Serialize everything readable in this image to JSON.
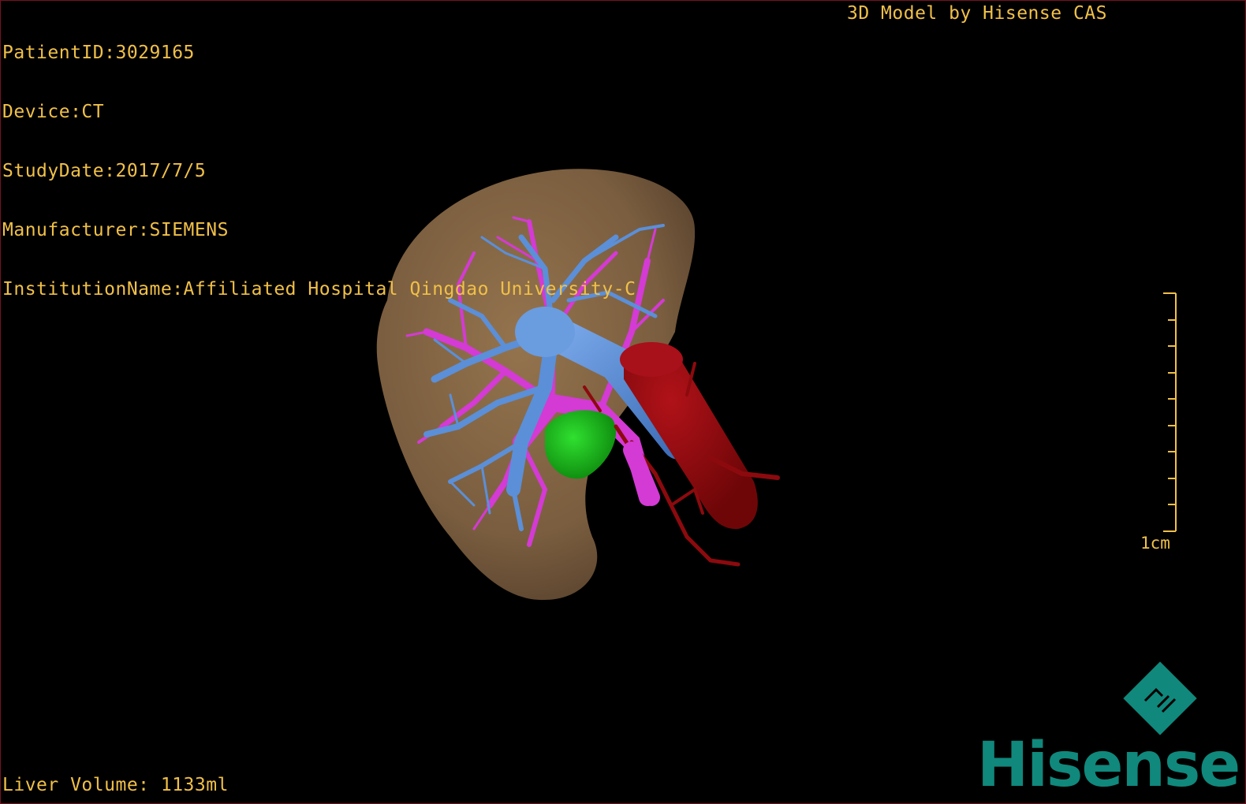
{
  "study_info": {
    "patient_id": "PatientID:3029165",
    "device": "Device:CT",
    "study_date": "StudyDate:2017/7/5",
    "manufacturer": "Manufacturer:SIEMENS",
    "institution": "InstitutionName:Affiliated Hospital Qingdao University-C"
  },
  "credit": "3D Model by Hisense CAS",
  "liver_volume": "Liver Volume: 1133ml",
  "scale_bar": {
    "label": "1cm",
    "tick_count": 10
  },
  "logo": {
    "wordmark": "Hisense",
    "emblem_icon": "hisense-diamond-emblem-icon"
  },
  "colors": {
    "overlay_text": "#f0c048",
    "liver": "#8a6a44",
    "hepatic_vein": "#5b8fd8",
    "portal_vein": "#d43ad4",
    "artery_ivc": "#8c0a0e",
    "gallbladder": "#18c81a",
    "logo": "#10887c",
    "frame_border": "#7a1020"
  }
}
